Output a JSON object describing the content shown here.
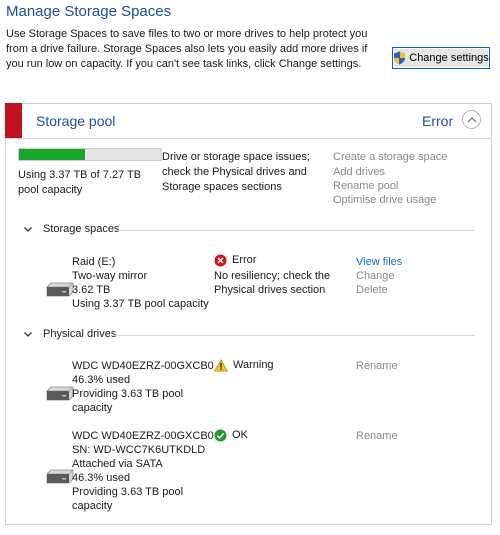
{
  "header": {
    "title": "Manage Storage Spaces",
    "intro": "Use Storage Spaces to save files to two or more drives to help protect you from a drive failure. Storage Spaces also lets you easily add more drives if you run low on capacity. If you can't see task links, click Change settings.",
    "change_settings_label": "Change settings"
  },
  "pool": {
    "title": "Storage pool",
    "status": "Error",
    "usage_fraction": 0.4635,
    "usage_text": "Using 3.37 TB of 7.27 TB pool capacity",
    "issue_text": "Drive or storage space issues; check the Physical drives and Storage spaces sections",
    "tasks": [
      "Create a storage space",
      "Add drives",
      "Rename pool",
      "Optimise drive usage"
    ]
  },
  "storage_spaces": {
    "title": "Storage spaces",
    "items": [
      {
        "name": "Raid (E:)",
        "type": "Two-way mirror",
        "size": "3.62 TB",
        "usage": "Using 3.37 TB pool capacity",
        "status": "Error",
        "status_detail_1": "No resiliency; check the",
        "status_detail_2": "Physical drives section",
        "actions": [
          "View files",
          "Change",
          "Delete"
        ]
      }
    ]
  },
  "physical_drives": {
    "title": "Physical drives",
    "items": [
      {
        "lines": [
          "WDC WD40EZRZ-00GXCB0",
          "46.3% used",
          "Providing 3.63 TB pool",
          "capacity"
        ],
        "status": "Warning",
        "action": "Rename"
      },
      {
        "lines": [
          "WDC WD40EZRZ-00GXCB0",
          "SN: WD-WCC7K6UTKDLD",
          "Attached via SATA",
          "46.3% used",
          "Providing 3.63 TB pool",
          "capacity"
        ],
        "status": "OK",
        "action": "Rename"
      }
    ]
  },
  "colors": {
    "accent": "#1b4e9b",
    "error": "#c1121f",
    "usage_bar": "#16a72c",
    "link": "#1b6fc2"
  },
  "icons": [
    "uac-shield-icon",
    "chevron-up-icon",
    "chevron-down-icon",
    "drive-icon",
    "error-icon",
    "warning-icon",
    "ok-icon"
  ]
}
